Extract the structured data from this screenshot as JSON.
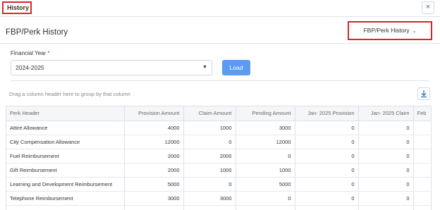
{
  "tab": {
    "label": "History"
  },
  "close_icon": "×",
  "page_title": "FBP/Perk History",
  "history_dropdown": {
    "value": "FBP/Perk History",
    "chevron": "⌄"
  },
  "form": {
    "fy_label": "Financial Year",
    "required_mark": "*",
    "fy_value": "2024-2025",
    "load_label": "Load"
  },
  "grid": {
    "group_hint": "Drag a column header here to group by that column",
    "columns": [
      "Perk Header",
      "Provision Amount",
      "Claim Amount",
      "Pending Amount",
      "Jan- 2025 Provision",
      "Jan- 2025 Claim",
      "Feb"
    ],
    "rows": [
      [
        "Attire Allowance",
        "4000",
        "1000",
        "3000",
        "0",
        "0"
      ],
      [
        "City Compensation Allowance",
        "12000",
        "0",
        "12000",
        "0",
        "0"
      ],
      [
        "Fuel Reimbursement",
        "2000",
        "2000",
        "0",
        "0",
        "0"
      ],
      [
        "Gift Reimbursement",
        "2000",
        "1000",
        "1000",
        "0",
        "0"
      ],
      [
        "Learning and Development Reimbursement",
        "5000",
        "0",
        "5000",
        "0",
        "0"
      ],
      [
        "Telephone Reimbursement",
        "3000",
        "3000",
        "0",
        "0",
        "0"
      ]
    ]
  },
  "colors": {
    "accent": "#5b9cf2",
    "highlight": "#d62828",
    "close": "#2f6fd1"
  },
  "icons": {
    "close": "close-icon",
    "export": "download-icon",
    "dropdown": "chevron-down-icon"
  }
}
